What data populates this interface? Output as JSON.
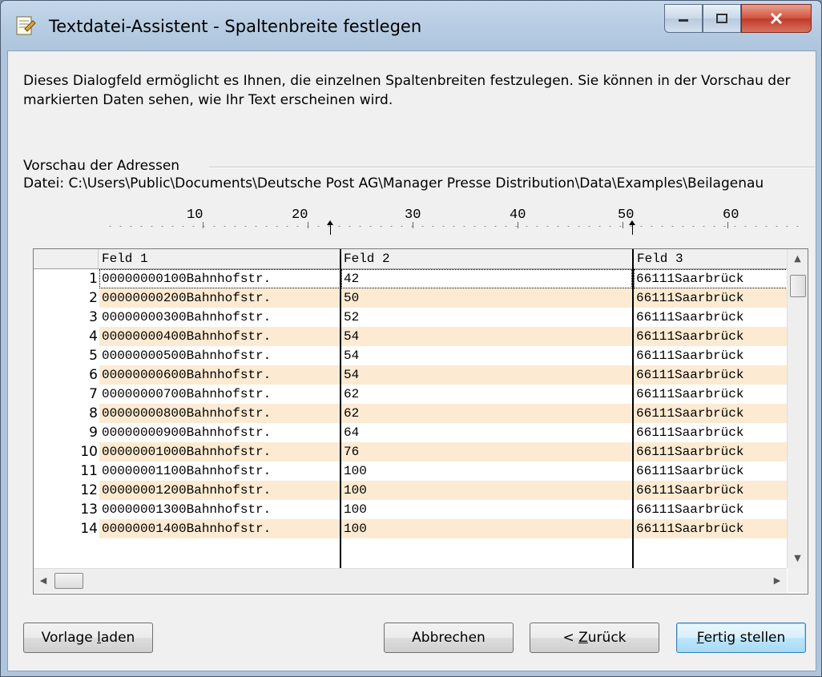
{
  "window": {
    "title": "Textdatei-Assistent - Spaltenbreite festlegen"
  },
  "intro_text": "Dieses Dialogfeld ermöglicht es Ihnen, die einzelnen Spaltenbreiten festzulegen. Sie können in der Vorschau der markierten Daten sehen, wie Ihr Text erscheinen wird.",
  "preview": {
    "group_label": "Vorschau der Adressen",
    "file_path": "Datei: C:\\Users\\Public\\Documents\\Deutsche Post AG\\Manager Presse Distribution\\Data\\Examples\\Beilagenau",
    "ruler_labels": [
      "10",
      "20",
      "30",
      "40",
      "50",
      "60"
    ]
  },
  "grid": {
    "headers": [
      "Feld 1",
      "Feld 2",
      "Feld 3"
    ],
    "rows": [
      {
        "n": "1",
        "f1": "00000000100Bahnhofstr.",
        "f2": "42",
        "f3": "66111Saarbrück"
      },
      {
        "n": "2",
        "f1": "00000000200Bahnhofstr.",
        "f2": "50",
        "f3": "66111Saarbrück"
      },
      {
        "n": "3",
        "f1": "00000000300Bahnhofstr.",
        "f2": "52",
        "f3": "66111Saarbrück"
      },
      {
        "n": "4",
        "f1": "00000000400Bahnhofstr.",
        "f2": "54",
        "f3": "66111Saarbrück"
      },
      {
        "n": "5",
        "f1": "00000000500Bahnhofstr.",
        "f2": "54",
        "f3": "66111Saarbrück"
      },
      {
        "n": "6",
        "f1": "00000000600Bahnhofstr.",
        "f2": "54",
        "f3": "66111Saarbrück"
      },
      {
        "n": "7",
        "f1": "00000000700Bahnhofstr.",
        "f2": "62",
        "f3": "66111Saarbrück"
      },
      {
        "n": "8",
        "f1": "00000000800Bahnhofstr.",
        "f2": "62",
        "f3": "66111Saarbrück"
      },
      {
        "n": "9",
        "f1": "00000000900Bahnhofstr.",
        "f2": "64",
        "f3": "66111Saarbrück"
      },
      {
        "n": "10",
        "f1": "00000001000Bahnhofstr.",
        "f2": "76",
        "f3": "66111Saarbrück"
      },
      {
        "n": "11",
        "f1": "00000001100Bahnhofstr.",
        "f2": "100",
        "f3": "66111Saarbrück"
      },
      {
        "n": "12",
        "f1": "00000001200Bahnhofstr.",
        "f2": "100",
        "f3": "66111Saarbrück"
      },
      {
        "n": "13",
        "f1": "00000001300Bahnhofstr.",
        "f2": "100",
        "f3": "66111Saarbrück"
      },
      {
        "n": "14",
        "f1": "00000001400Bahnhofstr.",
        "f2": "100",
        "f3": "66111Saarbrück"
      }
    ]
  },
  "buttons": {
    "load_template": {
      "pre": "Vorlage ",
      "acc": "l",
      "post": "aden"
    },
    "cancel": "Abbrechen",
    "back": {
      "pre": "< ",
      "acc": "Z",
      "post": "urück"
    },
    "finish": {
      "pre": "",
      "acc": "F",
      "post": "ertig stellen"
    }
  },
  "colors": {
    "row_alt": "#fcebd2",
    "title_bar": "#b8cde3",
    "close_button": "#c0392b",
    "default_button_border": "#3c7fb1"
  },
  "icons": {
    "app": "text-wizard-icon",
    "minimize": "minimize-icon",
    "maximize": "maximize-icon",
    "close": "close-icon"
  }
}
